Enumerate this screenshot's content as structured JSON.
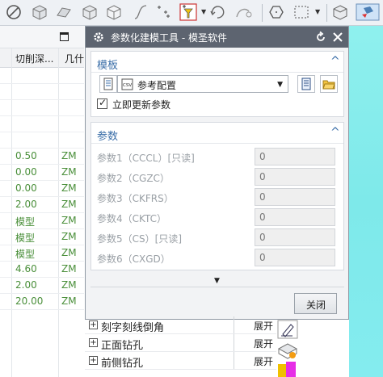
{
  "table": {
    "columns": [
      "切削深...",
      "几什"
    ],
    "rows": [
      {
        "a": "",
        "b": ""
      },
      {
        "a": "",
        "b": ""
      },
      {
        "a": "",
        "b": ""
      },
      {
        "a": "",
        "b": ""
      },
      {
        "a": "",
        "b": ""
      },
      {
        "a": "0.50",
        "b": "ZM"
      },
      {
        "a": "0.00",
        "b": "ZM"
      },
      {
        "a": "0.00",
        "b": "ZM"
      },
      {
        "a": "2.00",
        "b": "ZM"
      },
      {
        "a": "模型",
        "b": "ZM"
      },
      {
        "a": "模型",
        "b": "ZM"
      },
      {
        "a": "模型",
        "b": "ZM"
      },
      {
        "a": "4.60",
        "b": "ZM"
      },
      {
        "a": "2.00",
        "b": "ZM"
      },
      {
        "a": "20.00",
        "b": "ZM"
      }
    ]
  },
  "dialog": {
    "title": "参数化建模工具 - 模圣软件",
    "template_section": {
      "title": "模板",
      "combo_value": "参考配置",
      "checkbox_label": "立即更新参数",
      "checkbox_checked": true
    },
    "params_section": {
      "title": "参数",
      "params": [
        {
          "label": "参数1（CCCL）[只读]",
          "value": "0"
        },
        {
          "label": "参数2（CGZC）",
          "value": "0"
        },
        {
          "label": "参数3（CKFRS）",
          "value": "0"
        },
        {
          "label": "参数4（CKTC）",
          "value": "0"
        },
        {
          "label": "参数5（CS）[只读]",
          "value": "0"
        },
        {
          "label": "参数6（CXGD）",
          "value": "0"
        }
      ]
    },
    "close_label": "关闭"
  },
  "tree": [
    {
      "label": "刻字刻线倒角",
      "button": "展开"
    },
    {
      "label": "正面钻孔",
      "button": "展开"
    },
    {
      "label": "前侧钻孔",
      "button": "展开"
    }
  ],
  "colors": {
    "accent": "#3a6ea8",
    "title_bar": "#5d6470",
    "cyan_panel": "#84ecef",
    "green_text": "#4a8f3a"
  }
}
